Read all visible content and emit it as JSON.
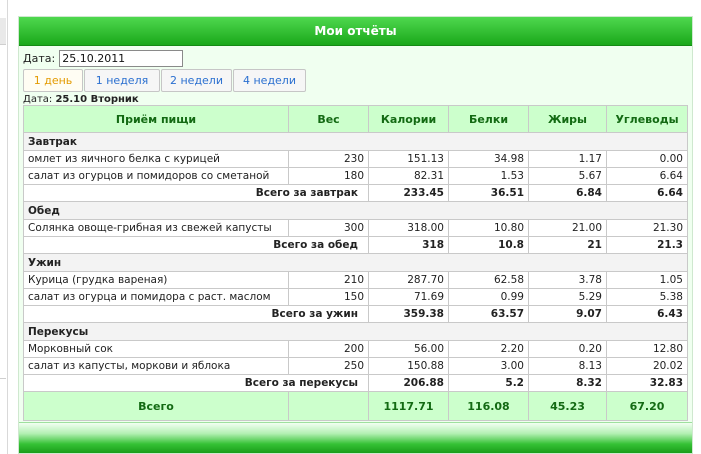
{
  "header": {
    "title": "Мои отчёты"
  },
  "date_filter": {
    "label": "Дата:",
    "value": "25.10.2011"
  },
  "tabs": [
    {
      "label": "1 день",
      "active": true
    },
    {
      "label": "1 неделя",
      "active": false
    },
    {
      "label": "2 недели",
      "active": false
    },
    {
      "label": "4 недели",
      "active": false
    }
  ],
  "day_line": {
    "prefix": "Дата:",
    "value": "25.10 Вторник"
  },
  "table": {
    "columns": [
      "Приём пищи",
      "Вес",
      "Калории",
      "Белки",
      "Жиры",
      "Углеводы"
    ],
    "sections": [
      {
        "name": "Завтрак",
        "items": [
          {
            "name": "омлет из яичного белка с курицей",
            "weight": "230",
            "kcal": "151.13",
            "protein": "34.98",
            "fat": "1.17",
            "carbs": "0.00"
          },
          {
            "name": "салат из огурцов и помидоров со сметаной",
            "weight": "180",
            "kcal": "82.31",
            "protein": "1.53",
            "fat": "5.67",
            "carbs": "6.64"
          }
        ],
        "total": {
          "label": "Всего за завтрак",
          "kcal": "233.45",
          "protein": "36.51",
          "fat": "6.84",
          "carbs": "6.64"
        }
      },
      {
        "name": "Обед",
        "items": [
          {
            "name": "Солянка овоще-грибная из свежей капусты",
            "weight": "300",
            "kcal": "318.00",
            "protein": "10.80",
            "fat": "21.00",
            "carbs": "21.30"
          }
        ],
        "total": {
          "label": "Всего за обед",
          "kcal": "318",
          "protein": "10.8",
          "fat": "21",
          "carbs": "21.3"
        }
      },
      {
        "name": "Ужин",
        "items": [
          {
            "name": "Курица (грудка вареная)",
            "weight": "210",
            "kcal": "287.70",
            "protein": "62.58",
            "fat": "3.78",
            "carbs": "1.05"
          },
          {
            "name": "салат из огурца и помидора с раст. маслом",
            "weight": "150",
            "kcal": "71.69",
            "protein": "0.99",
            "fat": "5.29",
            "carbs": "5.38"
          }
        ],
        "total": {
          "label": "Всего за ужин",
          "kcal": "359.38",
          "protein": "63.57",
          "fat": "9.07",
          "carbs": "6.43"
        }
      },
      {
        "name": "Перекусы",
        "items": [
          {
            "name": "Морковный сок",
            "weight": "200",
            "kcal": "56.00",
            "protein": "2.20",
            "fat": "0.20",
            "carbs": "12.80"
          },
          {
            "name": "салат из капусты, моркови и яблока",
            "weight": "250",
            "kcal": "150.88",
            "protein": "3.00",
            "fat": "8.13",
            "carbs": "20.02"
          }
        ],
        "total": {
          "label": "Всего за перекусы",
          "kcal": "206.88",
          "protein": "5.2",
          "fat": "8.32",
          "carbs": "32.83"
        }
      }
    ],
    "grand_total": {
      "label": "Всего",
      "kcal": "1117.71",
      "protein": "116.08",
      "fat": "45.23",
      "carbs": "67.20"
    }
  },
  "colors": {
    "header_green": "#1aa81a",
    "table_header_bg": "#ccffcc",
    "table_header_text": "#136a13",
    "active_tab_text": "#e39a00",
    "tab_text": "#2a6fd0"
  }
}
